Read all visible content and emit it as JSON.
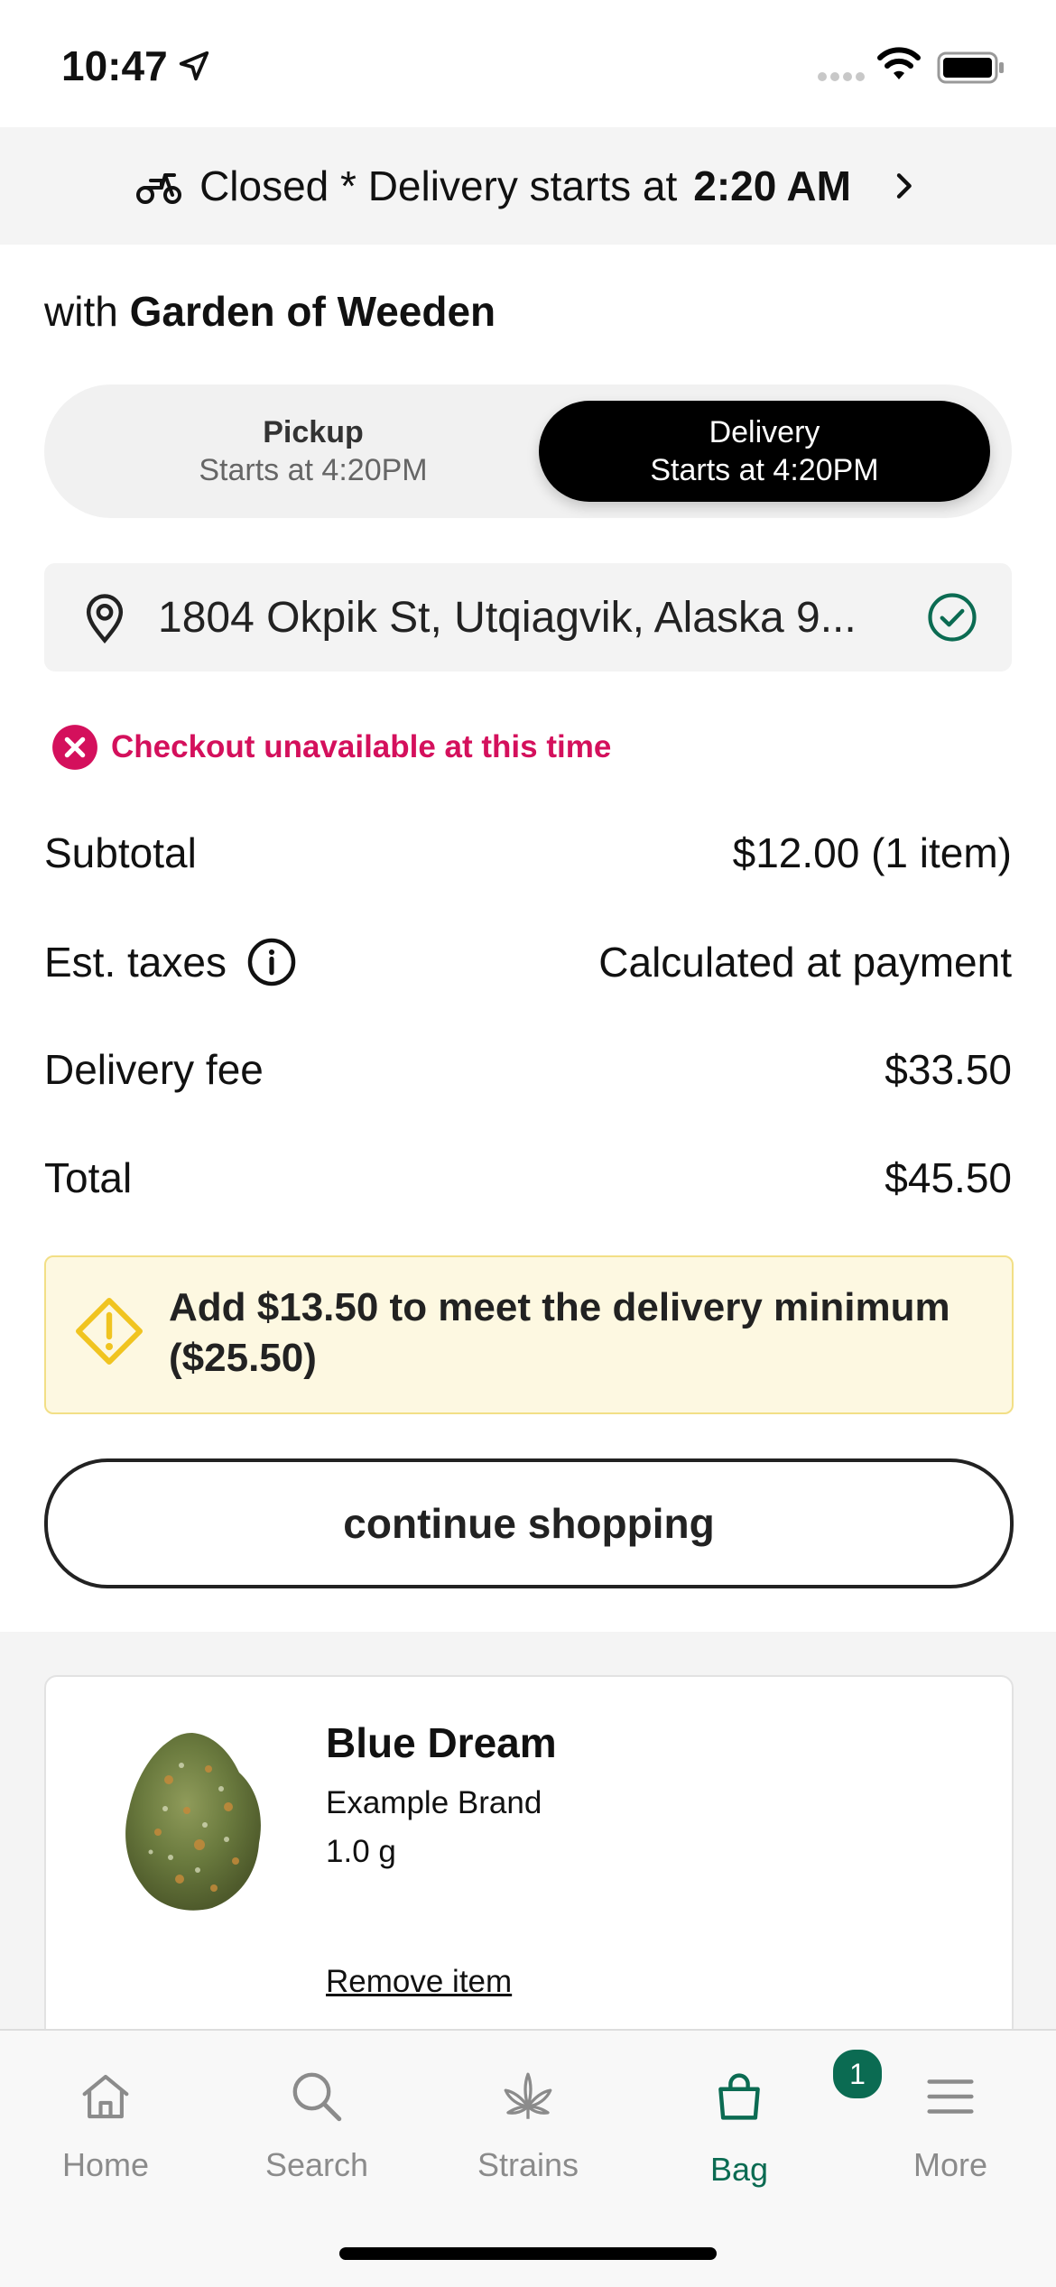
{
  "status_bar": {
    "time": "10:47"
  },
  "banner": {
    "status_text": "Closed * Delivery starts at",
    "time": "2:20 AM"
  },
  "store": {
    "prefix": "with",
    "name": "Garden of Weeden"
  },
  "fulfillment_toggle": {
    "pickup": {
      "label": "Pickup",
      "subtitle": "Starts at 4:20PM"
    },
    "delivery": {
      "label": "Delivery",
      "subtitle": "Starts at 4:20PM",
      "selected": true
    }
  },
  "address": {
    "value": "1804 Okpik St, Utqiagvik, Alaska 9..."
  },
  "error": {
    "message": "Checkout unavailable at this time"
  },
  "summary": {
    "subtotal_label": "Subtotal",
    "subtotal_value": "$12.00 (1 item)",
    "taxes_label": "Est. taxes",
    "taxes_value": "Calculated at payment",
    "delivery_fee_label": "Delivery fee",
    "delivery_fee_value": "$33.50",
    "total_label": "Total",
    "total_value": "$45.50"
  },
  "notice": {
    "text": "Add $13.50 to meet the delivery minimum ($25.50)"
  },
  "continue_button": {
    "label": "continue shopping"
  },
  "cart_item": {
    "name": "Blue Dream",
    "brand": "Example Brand",
    "size": "1.0 g",
    "remove_label": "Remove item"
  },
  "tab_bar": {
    "home": "Home",
    "search": "Search",
    "strains": "Strains",
    "bag": "Bag",
    "more": "More",
    "bag_badge": "1"
  },
  "colors": {
    "accent_green": "#0b6b52",
    "error_pink": "#d4105c",
    "notice_bg": "#fdf8e1",
    "notice_border": "#f2df86"
  }
}
